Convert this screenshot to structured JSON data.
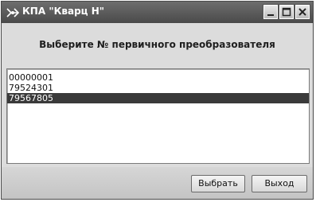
{
  "window": {
    "title": "КПА \"Кварц Н\"",
    "icon": "app-icon"
  },
  "titlebar_buttons": {
    "minimize_icon": "minimize-icon",
    "maximize_icon": "maximize-icon",
    "close_icon": "close-icon"
  },
  "prompt": "Выберите № первичного преобразователя",
  "list": {
    "items": [
      "00000001",
      "79524301",
      "79567805"
    ],
    "selected_index": 2
  },
  "buttons": {
    "select_label": "Выбрать",
    "exit_label": "Выход"
  },
  "colors": {
    "titlebar": "#4a4a4a",
    "selection": "#3a3a3a",
    "window_bg": "#dcdcdc"
  }
}
